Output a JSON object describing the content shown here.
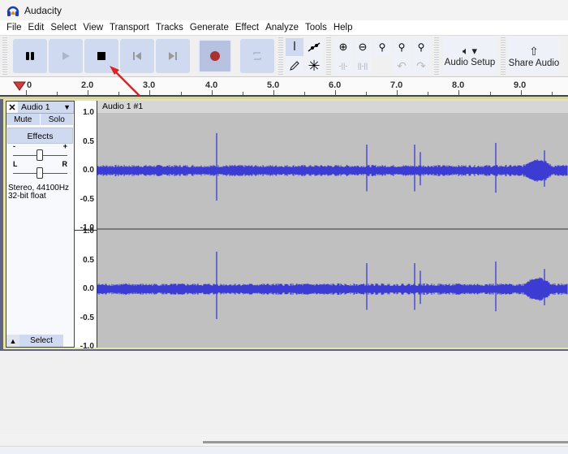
{
  "window": {
    "title": "Audacity"
  },
  "menu": [
    "File",
    "Edit",
    "Select",
    "View",
    "Transport",
    "Tracks",
    "Generate",
    "Effect",
    "Analyze",
    "Tools",
    "Help"
  ],
  "toolbar": {
    "transport": [
      {
        "name": "pause",
        "icon": "pause-icon"
      },
      {
        "name": "play",
        "icon": "play-icon"
      },
      {
        "name": "stop",
        "icon": "stop-icon"
      },
      {
        "name": "skip-start",
        "icon": "skip-start-icon"
      },
      {
        "name": "skip-end",
        "icon": "skip-end-icon"
      },
      {
        "name": "record",
        "icon": "record-icon"
      },
      {
        "name": "loop",
        "icon": "loop-icon"
      }
    ],
    "audio_setup_label": "Audio Setup",
    "share_audio_label": "Share Audio",
    "colors": {
      "button": "#cfdaf0",
      "record": "#a83232"
    }
  },
  "timeline": {
    "labels": [
      "0",
      "2.0",
      "3.0",
      "4.0",
      "5.0",
      "6.0",
      "7.0",
      "8.0",
      "9.0"
    ],
    "playhead_color": "#d04040"
  },
  "track": {
    "name": "Audio 1",
    "clip_name": "Audio 1 #1",
    "mute_label": "Mute",
    "solo_label": "Solo",
    "effects_label": "Effects",
    "gain_min": "-",
    "gain_max": "+",
    "pan_left": "L",
    "pan_right": "R",
    "format_line1": "Stereo, 44100Hz",
    "format_line2": "32-bit float",
    "select_label": "Select",
    "scale": [
      "1.0",
      "0.5",
      "0.0",
      "-0.5",
      "-1.0"
    ],
    "wave_color": "#3c3cd2",
    "bg_color": "#c0c0c0"
  }
}
